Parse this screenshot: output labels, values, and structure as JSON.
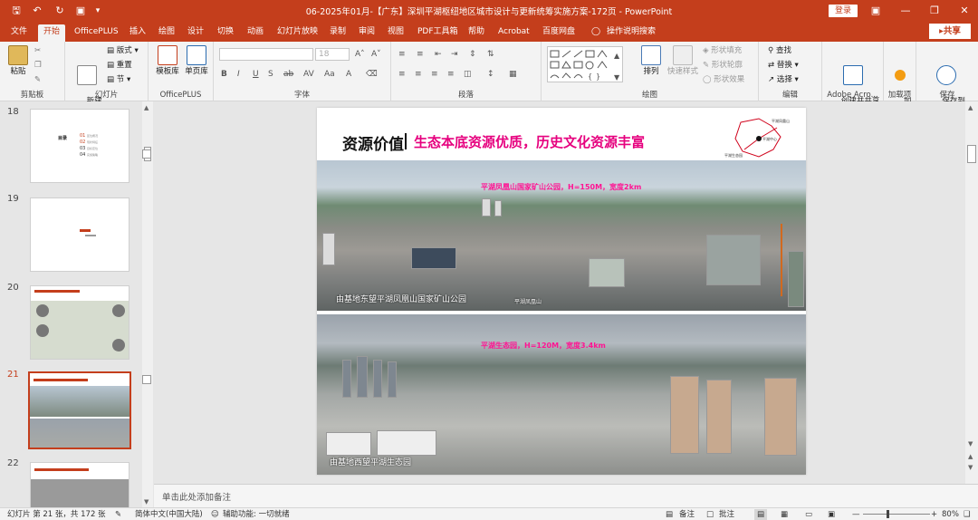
{
  "window": {
    "title": "06-2025年01月-【广东】深圳平湖枢纽地区城市设计与更新统筹实施方案-172页 - PowerPoint",
    "login_label": "登录",
    "accent": "#c43e1c",
    "quick_access": [
      "save-icon",
      "undo-icon",
      "redo-icon",
      "present-icon"
    ],
    "controls": [
      "ribbon-display-icon",
      "minimize-icon",
      "restore-icon",
      "close-icon"
    ]
  },
  "tabs": [
    "文件",
    "开始",
    "OfficePLUS",
    "插入",
    "绘图",
    "设计",
    "切换",
    "动画",
    "幻灯片放映",
    "录制",
    "审阅",
    "视图",
    "PDF工具箱",
    "帮助",
    "Acrobat",
    "百度网盘",
    "操作说明搜索"
  ],
  "active_tab": "开始",
  "share_label": "共享",
  "ribbon": {
    "clipboard": {
      "paste": "粘贴",
      "label": "剪贴板"
    },
    "slides": {
      "new_slide": "新建\n幻灯片",
      "layout": "版式",
      "reset": "重置",
      "section": "节",
      "label": "幻灯片"
    },
    "officeplus": {
      "template": "模板库",
      "single": "单页库",
      "label": "OfficePLUS"
    },
    "font": {
      "font_size": "18",
      "label": "字体"
    },
    "paragraph": {
      "label": "段落"
    },
    "drawing": {
      "arrange": "排列",
      "quick_styles": "快速样式",
      "fill": "形状填充",
      "outline": "形状轮廓",
      "effects": "形状效果",
      "label": "绘图"
    },
    "editing": {
      "find": "查找",
      "replace": "替换",
      "select": "选择",
      "label": "编辑"
    },
    "adobe": {
      "create": "创建并共享\nAdobe PDF",
      "label": "Adobe Acro..."
    },
    "addins": {
      "btn": "加\n载项",
      "label": "加载项"
    },
    "save": {
      "btn": "保存到\n百度网盘",
      "label": "保存"
    }
  },
  "thumbnails": [
    {
      "num": "18",
      "selected": false
    },
    {
      "num": "19",
      "selected": false
    },
    {
      "num": "20",
      "selected": false
    },
    {
      "num": "21",
      "selected": true
    },
    {
      "num": "22",
      "selected": false
    }
  ],
  "thumb18": {
    "title": "目录",
    "items": [
      [
        "01",
        "区位概况"
      ],
      [
        "02",
        "现状特征"
      ],
      [
        "03",
        "目标定位"
      ],
      [
        "04",
        "实施策略"
      ]
    ]
  },
  "slide": {
    "title_main": "资源价值",
    "title_sub": "生态本底资源优质，历史文化资源丰富",
    "map_labels": [
      "平湖凤凰山",
      "平湖生态园",
      "平湖中心"
    ],
    "photo1_caption": "平湖凤凰山国家矿山公园，H=150M，宽度2km",
    "photo1_label": "由基地东望平湖凤凰山国家矿山公园",
    "photo1_small": "平湖凤凰山",
    "photo2_caption": "平湖生态园，H=120M，宽度3.4km",
    "photo2_label": "由基地西望平湖生态园"
  },
  "notes_placeholder": "单击此处添加备注",
  "status": {
    "slide_info": "幻灯片 第 21 张，共 172 张",
    "language": "简体中文(中国大陆)",
    "accessibility": "辅助功能: 一切就绪",
    "notes": "备注",
    "comments": "批注",
    "zoom": "80%"
  }
}
